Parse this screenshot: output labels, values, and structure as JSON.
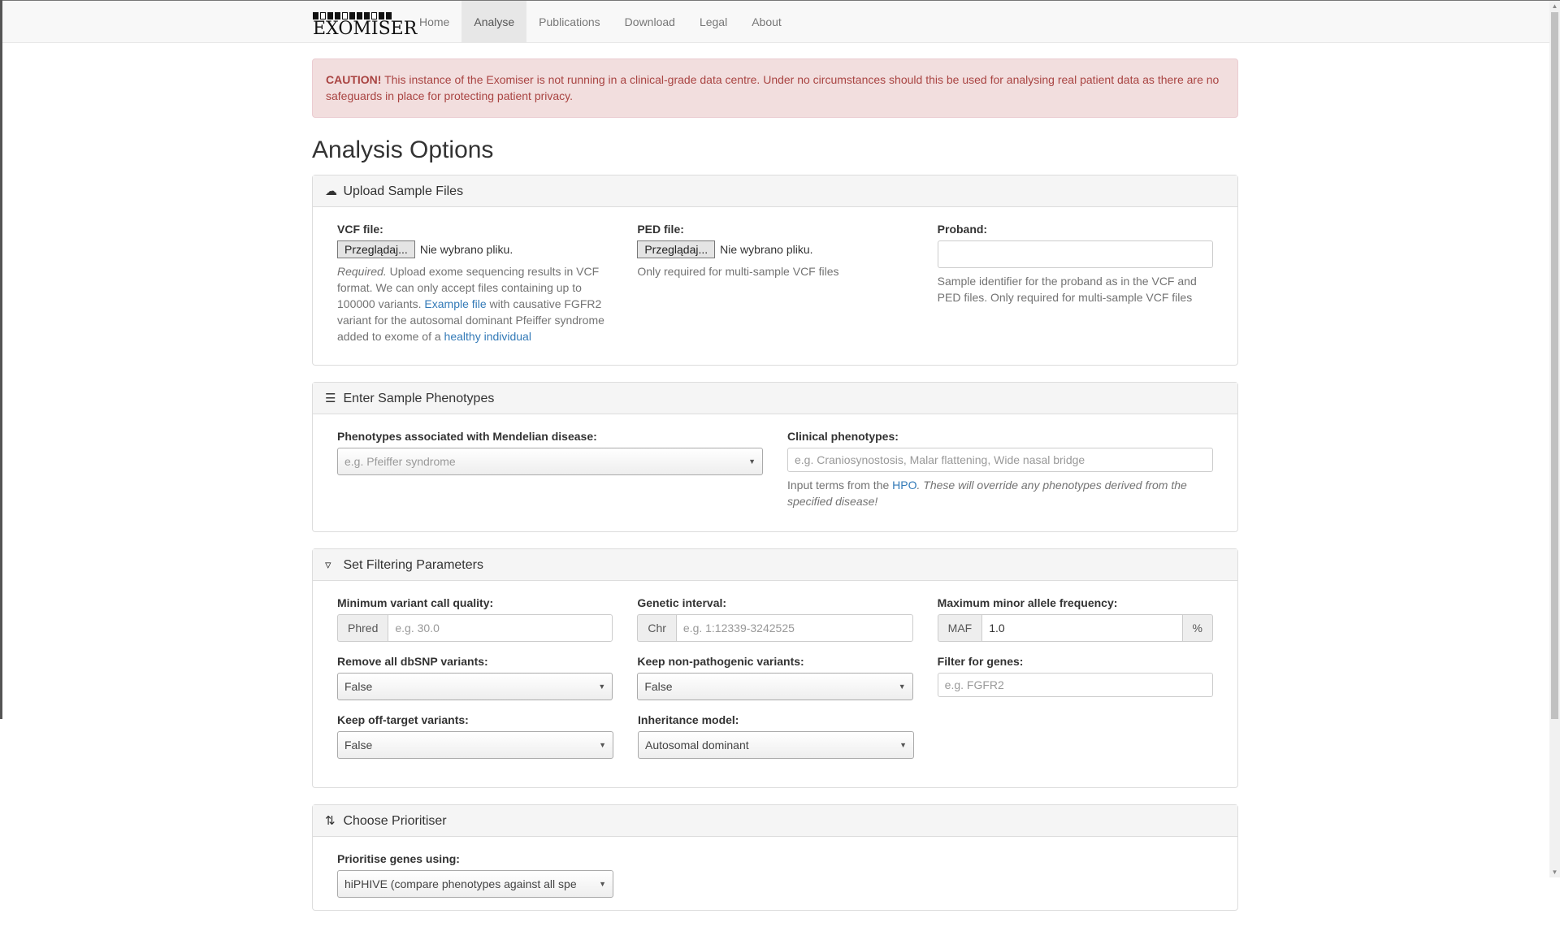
{
  "nav": {
    "brand": "EXOMISER",
    "items": [
      {
        "label": "Home",
        "active": false
      },
      {
        "label": "Analyse",
        "active": true
      },
      {
        "label": "Publications",
        "active": false
      },
      {
        "label": "Download",
        "active": false
      },
      {
        "label": "Legal",
        "active": false
      },
      {
        "label": "About",
        "active": false
      }
    ]
  },
  "alert": {
    "strong": "CAUTION!",
    "text": " This instance of the Exomiser is not running in a clinical-grade data centre. Under no circumstances should this be used for analysing real patient data as there are no safeguards in place for protecting patient privacy."
  },
  "page_title": "Analysis Options",
  "upload": {
    "heading": "Upload Sample Files",
    "vcf": {
      "label": "VCF file:",
      "button": "Przeglądaj...",
      "status": "Nie wybrano pliku.",
      "help_required": "Required.",
      "help_1": " Upload exome sequencing results in VCF format. We can only accept files containing up to 100000 variants. ",
      "example_link": "Example file",
      "help_2": " with causative FGFR2 variant for the autosomal dominant Pfeiffer syndrome added to exome of a ",
      "healthy_link": "healthy individual"
    },
    "ped": {
      "label": "PED file:",
      "button": "Przeglądaj...",
      "status": "Nie wybrano pliku.",
      "help": "Only required for multi-sample VCF files"
    },
    "proband": {
      "label": "Proband:",
      "value": "",
      "help": "Sample identifier for the proband as in the VCF and PED files. Only required for multi-sample VCF files"
    }
  },
  "phenotypes": {
    "heading": "Enter Sample Phenotypes",
    "mendelian": {
      "label": "Phenotypes associated with Mendelian disease:",
      "placeholder": "e.g. Pfeiffer syndrome"
    },
    "clinical": {
      "label": "Clinical phenotypes:",
      "placeholder": "e.g. Craniosynostosis, Malar flattening, Wide nasal bridge",
      "help_1": "Input terms from the ",
      "hpo_link": "HPO",
      "help_2": ". These will override any phenotypes derived from the specified disease!"
    }
  },
  "filtering": {
    "heading": "Set Filtering Parameters",
    "min_quality": {
      "label": "Minimum variant call quality:",
      "addon": "Phred",
      "placeholder": "e.g. 30.0"
    },
    "interval": {
      "label": "Genetic interval:",
      "addon": "Chr",
      "placeholder": "e.g. 1:12339-3242525"
    },
    "maf": {
      "label": "Maximum minor allele frequency:",
      "addon": "MAF",
      "value": "1.0",
      "suffix": "%"
    },
    "dbsnp": {
      "label": "Remove all dbSNP variants:",
      "value": "False"
    },
    "non_pathogenic": {
      "label": "Keep non-pathogenic variants:",
      "value": "False"
    },
    "genes": {
      "label": "Filter for genes:",
      "placeholder": "e.g. FGFR2"
    },
    "off_target": {
      "label": "Keep off-target variants:",
      "value": "False"
    },
    "inheritance": {
      "label": "Inheritance model:",
      "value": "Autosomal dominant"
    }
  },
  "prioritiser": {
    "heading": "Choose Prioritiser",
    "label": "Prioritise genes using:",
    "value": "hiPHIVE (compare phenotypes against all spe"
  },
  "icons": {
    "upload": "cloud-upload-icon",
    "phenotypes": "list-icon",
    "filter": "filter-icon",
    "sort": "sort-icon",
    "dropdown": "chevron-down-icon"
  }
}
